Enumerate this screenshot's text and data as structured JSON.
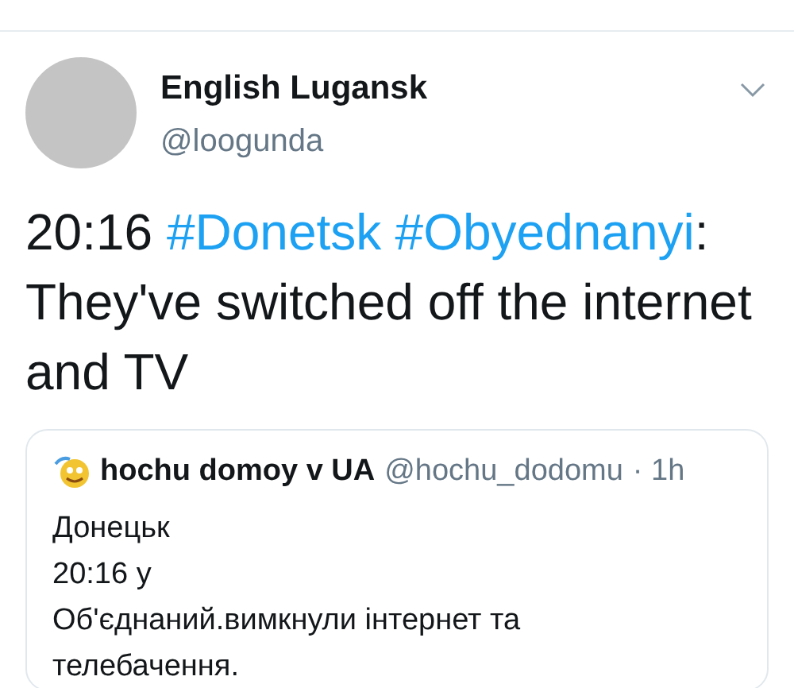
{
  "author": {
    "name": "English Lugansk",
    "handle": "@loogunda"
  },
  "tweet": {
    "segments": [
      {
        "kind": "text",
        "text": "20:16 "
      },
      {
        "kind": "hashtag",
        "text": "#Donetsk"
      },
      {
        "kind": "hashtag",
        "text": "#Obyednanyi"
      },
      {
        "kind": "text",
        "text": ": They've switched off the internet and TV"
      }
    ]
  },
  "quoted": {
    "name": "hochu domoy v UA",
    "handle": "@hochu_dodomu",
    "time": "· 1h",
    "text": "Донецьк\n20:16 у\nОб'єднаний.вимкнули інтернет та телебачення."
  }
}
